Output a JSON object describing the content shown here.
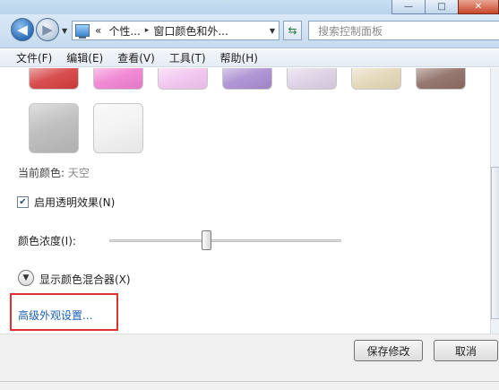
{
  "window": {
    "buttons": {
      "minimize": "—",
      "maximize": "□",
      "close": "✕"
    }
  },
  "nav": {
    "back_icon": "arrow-left-icon",
    "forward_icon": "arrow-right-icon",
    "address": {
      "prefix": "«",
      "crumb1": "个性...",
      "separator": "▸",
      "crumb2": "窗口颜色和外..."
    },
    "search_placeholder": "搜索控制面板"
  },
  "menu": {
    "items": [
      "文件(F)",
      "编辑(E)",
      "查看(V)",
      "工具(T)",
      "帮助(H)"
    ]
  },
  "swatches": {
    "top_row_colors": [
      "#d43c3c",
      "#f07ed0",
      "#f1c3ef",
      "#a88bd0",
      "#dcd0e4",
      "#e3d6b6",
      "#8c6a62"
    ],
    "bottom_row_colors": [
      "#b9b9b9",
      "#f2f2f2"
    ]
  },
  "current_color": {
    "label": "当前颜色:",
    "value": "天空"
  },
  "transparency": {
    "label": "启用透明效果(N)",
    "checked": true
  },
  "intensity": {
    "label": "颜色浓度(I):",
    "level_percent": 42
  },
  "mixer": {
    "label": "显示颜色混合器(X)"
  },
  "advanced": {
    "link": "高级外观设置..."
  },
  "footer": {
    "save": "保存修改",
    "cancel": "取消"
  },
  "colors": {
    "accent_link": "#1a5fb4",
    "highlight_box": "#e23030"
  }
}
